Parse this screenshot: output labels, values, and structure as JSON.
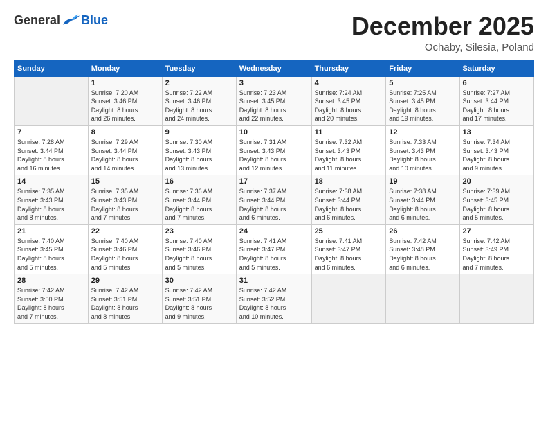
{
  "logo": {
    "general": "General",
    "blue": "Blue"
  },
  "header": {
    "month": "December 2025",
    "location": "Ochaby, Silesia, Poland"
  },
  "days_of_week": [
    "Sunday",
    "Monday",
    "Tuesday",
    "Wednesday",
    "Thursday",
    "Friday",
    "Saturday"
  ],
  "weeks": [
    [
      {
        "day": "",
        "info": ""
      },
      {
        "day": "1",
        "info": "Sunrise: 7:20 AM\nSunset: 3:46 PM\nDaylight: 8 hours\nand 26 minutes."
      },
      {
        "day": "2",
        "info": "Sunrise: 7:22 AM\nSunset: 3:46 PM\nDaylight: 8 hours\nand 24 minutes."
      },
      {
        "day": "3",
        "info": "Sunrise: 7:23 AM\nSunset: 3:45 PM\nDaylight: 8 hours\nand 22 minutes."
      },
      {
        "day": "4",
        "info": "Sunrise: 7:24 AM\nSunset: 3:45 PM\nDaylight: 8 hours\nand 20 minutes."
      },
      {
        "day": "5",
        "info": "Sunrise: 7:25 AM\nSunset: 3:45 PM\nDaylight: 8 hours\nand 19 minutes."
      },
      {
        "day": "6",
        "info": "Sunrise: 7:27 AM\nSunset: 3:44 PM\nDaylight: 8 hours\nand 17 minutes."
      }
    ],
    [
      {
        "day": "7",
        "info": "Sunrise: 7:28 AM\nSunset: 3:44 PM\nDaylight: 8 hours\nand 16 minutes."
      },
      {
        "day": "8",
        "info": "Sunrise: 7:29 AM\nSunset: 3:44 PM\nDaylight: 8 hours\nand 14 minutes."
      },
      {
        "day": "9",
        "info": "Sunrise: 7:30 AM\nSunset: 3:43 PM\nDaylight: 8 hours\nand 13 minutes."
      },
      {
        "day": "10",
        "info": "Sunrise: 7:31 AM\nSunset: 3:43 PM\nDaylight: 8 hours\nand 12 minutes."
      },
      {
        "day": "11",
        "info": "Sunrise: 7:32 AM\nSunset: 3:43 PM\nDaylight: 8 hours\nand 11 minutes."
      },
      {
        "day": "12",
        "info": "Sunrise: 7:33 AM\nSunset: 3:43 PM\nDaylight: 8 hours\nand 10 minutes."
      },
      {
        "day": "13",
        "info": "Sunrise: 7:34 AM\nSunset: 3:43 PM\nDaylight: 8 hours\nand 9 minutes."
      }
    ],
    [
      {
        "day": "14",
        "info": "Sunrise: 7:35 AM\nSunset: 3:43 PM\nDaylight: 8 hours\nand 8 minutes."
      },
      {
        "day": "15",
        "info": "Sunrise: 7:35 AM\nSunset: 3:43 PM\nDaylight: 8 hours\nand 7 minutes."
      },
      {
        "day": "16",
        "info": "Sunrise: 7:36 AM\nSunset: 3:44 PM\nDaylight: 8 hours\nand 7 minutes."
      },
      {
        "day": "17",
        "info": "Sunrise: 7:37 AM\nSunset: 3:44 PM\nDaylight: 8 hours\nand 6 minutes."
      },
      {
        "day": "18",
        "info": "Sunrise: 7:38 AM\nSunset: 3:44 PM\nDaylight: 8 hours\nand 6 minutes."
      },
      {
        "day": "19",
        "info": "Sunrise: 7:38 AM\nSunset: 3:44 PM\nDaylight: 8 hours\nand 6 minutes."
      },
      {
        "day": "20",
        "info": "Sunrise: 7:39 AM\nSunset: 3:45 PM\nDaylight: 8 hours\nand 5 minutes."
      }
    ],
    [
      {
        "day": "21",
        "info": "Sunrise: 7:40 AM\nSunset: 3:45 PM\nDaylight: 8 hours\nand 5 minutes."
      },
      {
        "day": "22",
        "info": "Sunrise: 7:40 AM\nSunset: 3:46 PM\nDaylight: 8 hours\nand 5 minutes."
      },
      {
        "day": "23",
        "info": "Sunrise: 7:40 AM\nSunset: 3:46 PM\nDaylight: 8 hours\nand 5 minutes."
      },
      {
        "day": "24",
        "info": "Sunrise: 7:41 AM\nSunset: 3:47 PM\nDaylight: 8 hours\nand 5 minutes."
      },
      {
        "day": "25",
        "info": "Sunrise: 7:41 AM\nSunset: 3:47 PM\nDaylight: 8 hours\nand 6 minutes."
      },
      {
        "day": "26",
        "info": "Sunrise: 7:42 AM\nSunset: 3:48 PM\nDaylight: 8 hours\nand 6 minutes."
      },
      {
        "day": "27",
        "info": "Sunrise: 7:42 AM\nSunset: 3:49 PM\nDaylight: 8 hours\nand 7 minutes."
      }
    ],
    [
      {
        "day": "28",
        "info": "Sunrise: 7:42 AM\nSunset: 3:50 PM\nDaylight: 8 hours\nand 7 minutes."
      },
      {
        "day": "29",
        "info": "Sunrise: 7:42 AM\nSunset: 3:51 PM\nDaylight: 8 hours\nand 8 minutes."
      },
      {
        "day": "30",
        "info": "Sunrise: 7:42 AM\nSunset: 3:51 PM\nDaylight: 8 hours\nand 9 minutes."
      },
      {
        "day": "31",
        "info": "Sunrise: 7:42 AM\nSunset: 3:52 PM\nDaylight: 8 hours\nand 10 minutes."
      },
      {
        "day": "",
        "info": ""
      },
      {
        "day": "",
        "info": ""
      },
      {
        "day": "",
        "info": ""
      }
    ]
  ]
}
